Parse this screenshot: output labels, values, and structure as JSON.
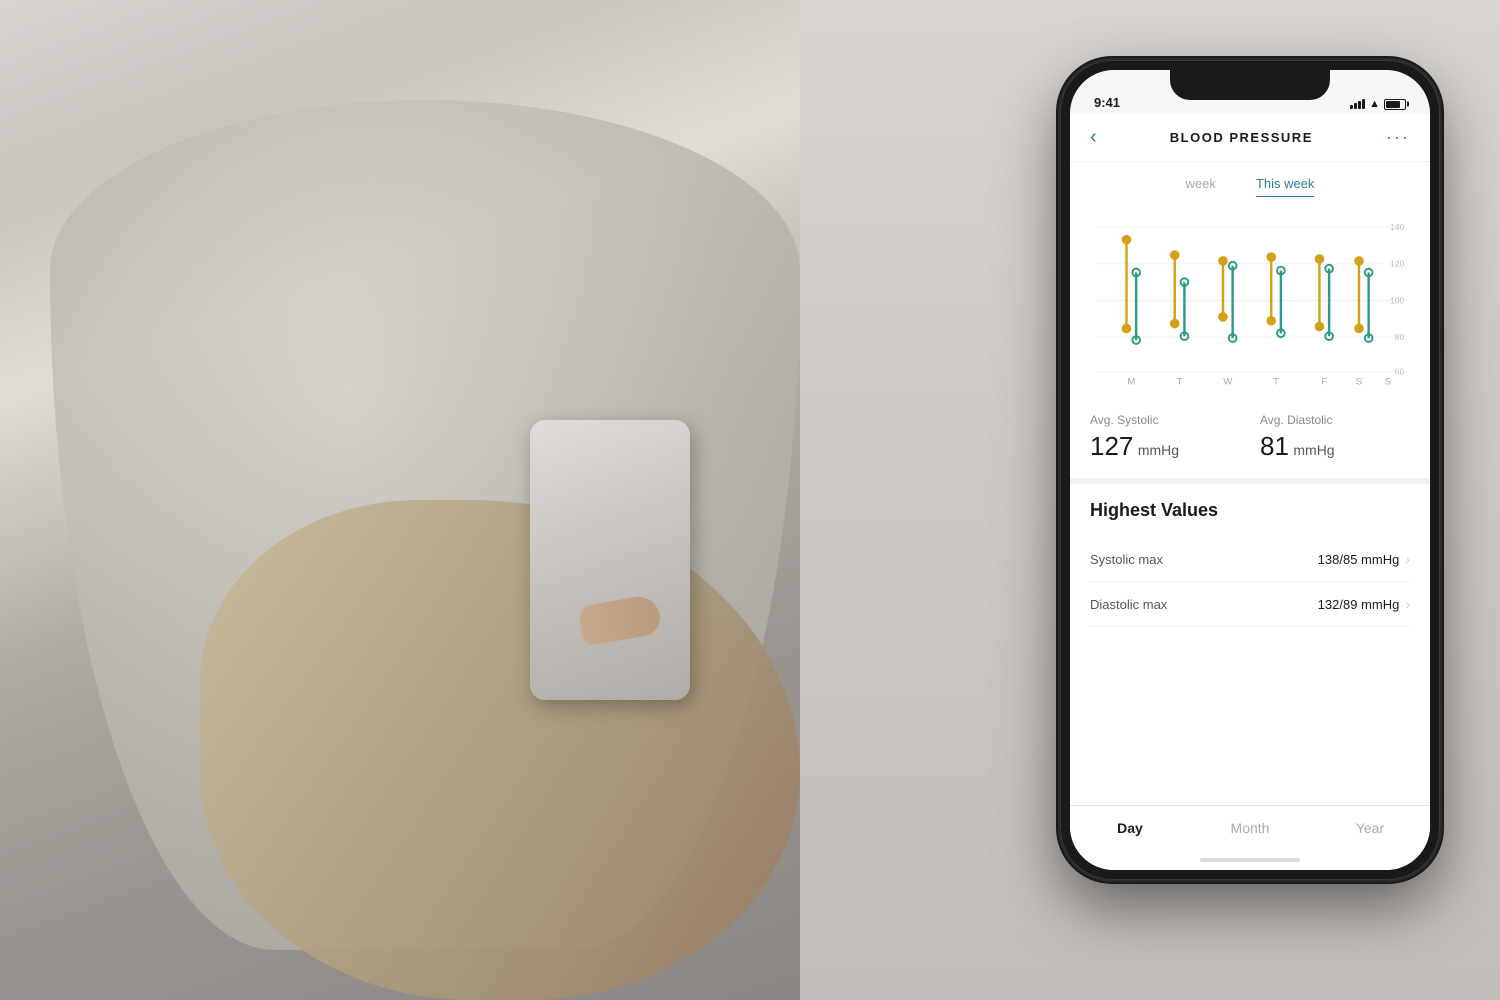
{
  "background": {
    "description": "man with blood pressure monitor"
  },
  "phone": {
    "status_bar": {
      "time": "9:41",
      "signal_label": "signal",
      "wifi_label": "wifi",
      "battery_label": "battery"
    },
    "header": {
      "back_label": "‹",
      "title": "BLOOD PRESSURE",
      "more_label": "···"
    },
    "tabs": [
      {
        "label": "week",
        "active": false
      },
      {
        "label": "This week",
        "active": true
      }
    ],
    "chart": {
      "y_labels": [
        "140",
        "120",
        "100",
        "80",
        "60"
      ],
      "x_labels": [
        "M",
        "T",
        "W",
        "T",
        "F",
        "S",
        "S"
      ],
      "accent_color_systolic": "#d4a017",
      "accent_color_diastolic": "#2d9a8a"
    },
    "stats": {
      "systolic": {
        "label": "Avg. Systolic",
        "value": "127",
        "unit": "mmHg"
      },
      "diastolic": {
        "label": "Avg. Diastolic",
        "value": "81",
        "unit": "mmHg"
      }
    },
    "highest_values": {
      "title": "Highest Values",
      "items": [
        {
          "label": "Systolic max",
          "value": "138/85 mmHg",
          "chevron": "›"
        },
        {
          "label": "Diastolic max",
          "value": "132/89 mmHg",
          "chevron": "›"
        }
      ]
    },
    "bottom_tabs": [
      {
        "label": "Day",
        "active": true
      },
      {
        "label": "Month",
        "active": false
      },
      {
        "label": "Year",
        "active": false
      }
    ]
  }
}
